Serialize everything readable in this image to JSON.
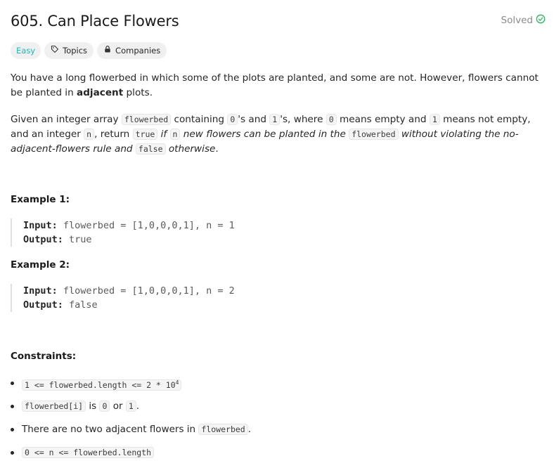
{
  "problem": {
    "title": "605. Can Place Flowers",
    "status": "Solved",
    "status_icon": "check-circle-icon",
    "status_color": "#2db55d"
  },
  "tags": {
    "difficulty": "Easy",
    "difficulty_color": "#1cb8b8",
    "topics": "Topics",
    "topics_icon": "tag-icon",
    "companies": "Companies",
    "companies_icon": "lock-icon"
  },
  "description": {
    "p1_a": "You have a long flowerbed in which some of the plots are planted, and some are not. However, flowers cannot be planted in ",
    "p1_b": "adjacent",
    "p1_c": " plots.",
    "p2": {
      "t1": "Given an integer array ",
      "c1": "flowerbed",
      "t2": " containing ",
      "c2": "0",
      "t3": "'s and ",
      "c3": "1",
      "t4": "'s, where ",
      "c4": "0",
      "t5": " means empty and ",
      "c5": "1",
      "t6": " means not empty, and an integer ",
      "c6": "n",
      "t7": ", return ",
      "c7": "true",
      "i1": " if ",
      "c8": "n",
      "i2": " new flowers can be planted in the ",
      "c9": "flowerbed",
      "i3": " without violating the no-adjacent-flowers rule and ",
      "c10": "false",
      "i4": " otherwise",
      "t8": "."
    }
  },
  "examples": [
    {
      "title": "Example 1:",
      "input_label": "Input:",
      "input": "flowerbed = [1,0,0,0,1], n = 1",
      "output_label": "Output:",
      "output": "true"
    },
    {
      "title": "Example 2:",
      "input_label": "Input:",
      "input": "flowerbed = [1,0,0,0,1], n = 2",
      "output_label": "Output:",
      "output": "false"
    }
  ],
  "constraints": {
    "title": "Constraints:",
    "c1_code": "1 <= flowerbed.length <= 2 * 10",
    "c1_sup": "4",
    "c2_code": "flowerbed[i]",
    "c2_t1": " is ",
    "c2_c2": "0",
    "c2_t2": " or ",
    "c2_c3": "1",
    "c2_t3": ".",
    "c3_t1": "There are no two adjacent flowers in ",
    "c3_code": "flowerbed",
    "c3_t2": ".",
    "c4_code": "0 <= n <= flowerbed.length"
  }
}
